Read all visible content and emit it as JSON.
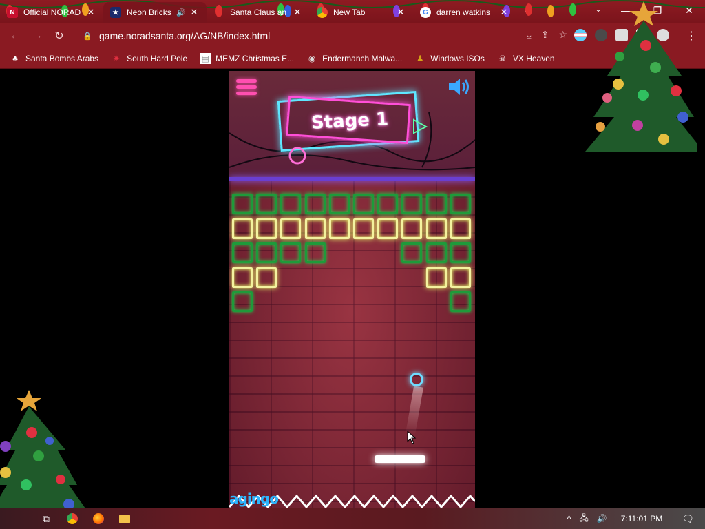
{
  "browser": {
    "tabs": [
      {
        "title": "Official NORAD",
        "favicon": "norad-icon",
        "active": false
      },
      {
        "title": "Neon Bricks",
        "favicon": "game-icon",
        "active": true,
        "audio": true
      },
      {
        "title": "Santa Claus an",
        "favicon": "santa-icon",
        "active": false
      },
      {
        "title": "New Tab",
        "favicon": "chrome-icon",
        "active": false
      },
      {
        "title": "darren watkins",
        "favicon": "google-icon",
        "active": false
      }
    ],
    "url": "game.noradsanta.org/AG/NB/index.html",
    "bookmarks": [
      {
        "label": "Santa Bombs Arabs",
        "icon": "santa-icon"
      },
      {
        "label": "South Hard Pole",
        "icon": "star-icon"
      },
      {
        "label": "MEMZ Christmas E...",
        "icon": "page-icon"
      },
      {
        "label": "Endermanch Malwa...",
        "icon": "raccoon-icon"
      },
      {
        "label": "Windows ISOs",
        "icon": "person-icon"
      },
      {
        "label": "VX Heaven",
        "icon": "skull-icon"
      }
    ],
    "theme_color": "#8a1a22"
  },
  "game": {
    "stage_label": "Stage 1",
    "brick_rows": [
      {
        "color": "green",
        "cols": [
          0,
          1,
          2,
          3,
          4,
          5,
          6,
          7,
          8,
          9
        ]
      },
      {
        "color": "yellow",
        "cols": [
          0,
          1,
          2,
          3,
          4,
          5,
          6,
          7,
          8,
          9
        ]
      },
      {
        "color": "green",
        "cols": [
          0,
          1,
          2,
          3,
          7,
          8,
          9
        ]
      },
      {
        "color": "yellow",
        "cols": [
          0,
          1,
          8,
          9
        ]
      },
      {
        "color": "green",
        "cols": [
          0,
          9
        ]
      }
    ],
    "logo_text": "agingo",
    "colors": {
      "green": "#1fd14a",
      "yellow": "#e8ff6a",
      "ball": "#6fdcff",
      "menu": "#ff4fb0"
    }
  },
  "taskbar": {
    "time": "7:11:01 PM"
  }
}
